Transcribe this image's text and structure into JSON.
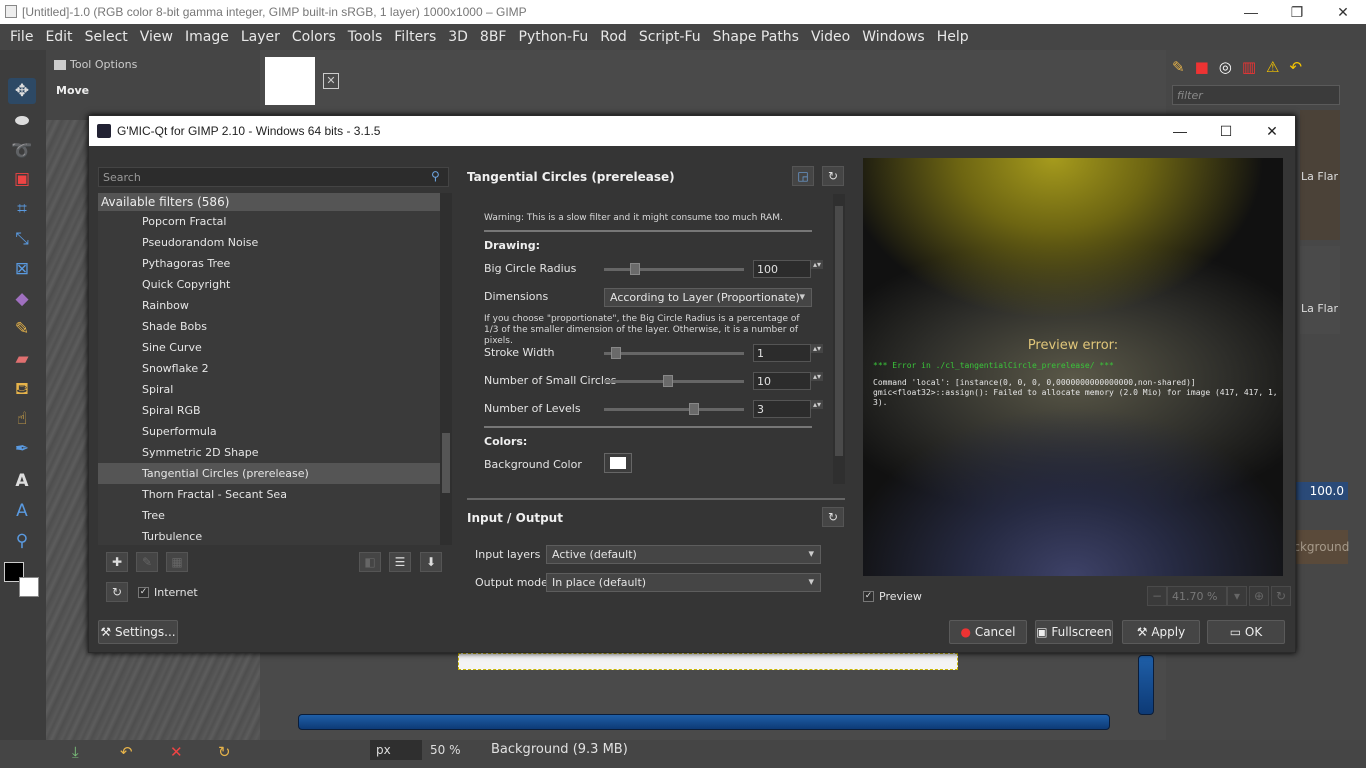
{
  "window": {
    "title": "[Untitled]-1.0 (RGB color 8-bit gamma integer, GIMP built-in sRGB, 1 layer) 1000x1000 – GIMP",
    "minimize": "—",
    "maximize": "❐",
    "close": "✕"
  },
  "menubar": [
    "File",
    "Edit",
    "Select",
    "View",
    "Image",
    "Layer",
    "Colors",
    "Tools",
    "Filters",
    "3D",
    "8BF",
    "Python-Fu",
    "Rod",
    "Script-Fu",
    "Shape Paths",
    "Video",
    "Windows",
    "Help"
  ],
  "tool_options": {
    "title": "Tool Options",
    "tool_name": "Move",
    "move_label": "Move",
    "tool_label": "Tool"
  },
  "right_dock": {
    "filter_placeholder": "filter",
    "brush_label_1": "La Flar",
    "brush_label_2": "La Flar",
    "zoom_value": "100.0",
    "layer_button": "ackground"
  },
  "statusbar": {
    "unit": "px",
    "zoom": "50 %",
    "layer_info": "Background (9.3 MB)"
  },
  "gmic": {
    "title": "G'MIC-Qt for GIMP 2.10 - Windows 64 bits - 3.1.5",
    "search_placeholder": "Search",
    "filters_header": "Available filters (586)",
    "filters": [
      "Popcorn Fractal",
      "Pseudorandom Noise",
      "Pythagoras Tree",
      "Quick Copyright",
      "Rainbow",
      "Shade Bobs",
      "Sine Curve",
      "Snowflake 2",
      "Spiral",
      "Spiral RGB",
      "Superformula",
      "Symmetric 2D Shape",
      "Tangential Circles (prerelease)",
      "Thorn Fractal - Secant Sea",
      "Tree",
      "Turbulence"
    ],
    "selected_filter": "Tangential Circles (prerelease)",
    "internet_label": "Internet",
    "settings_button": "Settings...",
    "params": {
      "title": "Tangential Circles (prerelease)",
      "warning": "Warning: This is a slow filter and it might consume too much RAM.",
      "drawing_section": "Drawing:",
      "big_radius_label": "Big Circle Radius",
      "big_radius_value": "100",
      "dimensions_label": "Dimensions",
      "dimensions_value": "According to Layer (Proportionate)",
      "dimensions_note": "If you choose \"proportionate\", the Big Circle Radius is a percentage of 1/3 of the smaller dimension of the layer. Otherwise, it is a number of pixels.",
      "stroke_label": "Stroke Width",
      "stroke_value": "1",
      "small_circles_label": "Number of Small Circles",
      "small_circles_value": "10",
      "levels_label": "Number of Levels",
      "levels_value": "3",
      "colors_section": "Colors:",
      "bg_color_label": "Background Color",
      "big_radius_slider": 0.2,
      "stroke_slider": 0.05,
      "small_circles_slider": 0.45,
      "levels_slider": 0.65
    },
    "io": {
      "title": "Input / Output",
      "input_label": "Input layers",
      "input_value": "Active (default)",
      "output_label": "Output mode",
      "output_value": "In place (default)"
    },
    "preview": {
      "error_title": "Preview error:",
      "error_line1": "*** Error in ./cl_tangentialCircle_prerelease/ ***",
      "error_line2": "Command 'local': [instance(0, 0, 0, 0,0000000000000000,non-shared)] gmic<float32>::assign(): Failed to allocate memory (2.0 Mio) for image (417, 417, 1, 3).",
      "preview_label": "Preview",
      "zoom_value": "41.70 %"
    },
    "buttons": {
      "cancel": "Cancel",
      "fullscreen": "Fullscreen",
      "apply": "Apply",
      "ok": "OK"
    }
  }
}
